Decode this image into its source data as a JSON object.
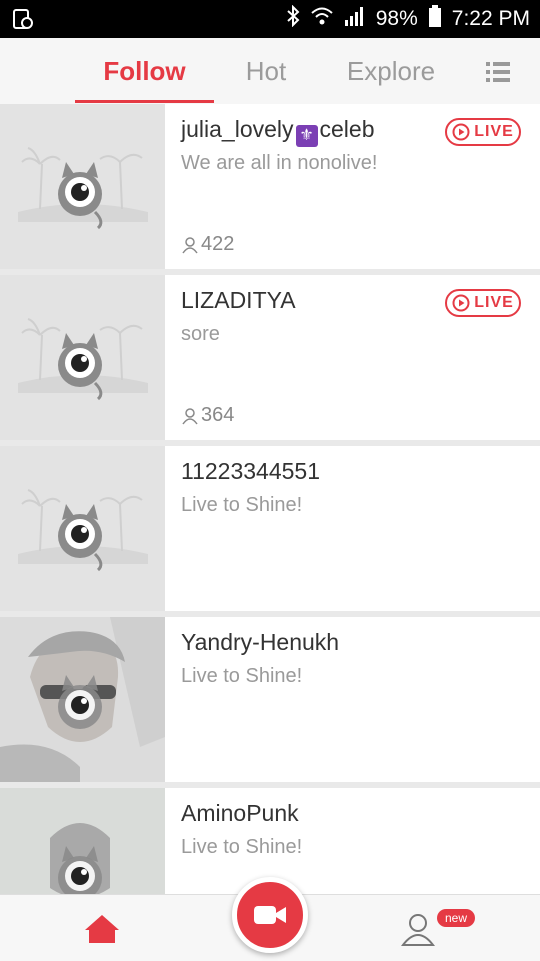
{
  "status_bar": {
    "battery": "98%",
    "time": "7:22 PM"
  },
  "tabs": [
    {
      "label": "Follow",
      "active": true
    },
    {
      "label": "Hot",
      "active": false
    },
    {
      "label": "Explore",
      "active": false
    }
  ],
  "live_label": "LIVE",
  "feed": [
    {
      "name_part1": "julia_lovely",
      "name_symbol": "⚜",
      "name_part2": "celeb",
      "bio": "We are all in nonolive!",
      "viewers": "422",
      "live": true
    },
    {
      "name": "LIZADITYA",
      "bio": "sore",
      "viewers": "364",
      "live": true
    },
    {
      "name": "11223344551",
      "bio": "Live to Shine!",
      "live": false
    },
    {
      "name": "Yandry-Henukh",
      "bio": "Live to Shine!",
      "live": false
    },
    {
      "name": "AminoPunk",
      "bio": "Live to Shine!",
      "live": false
    }
  ],
  "bottom_nav": {
    "new_badge": "new"
  },
  "colors": {
    "accent": "#e53a44",
    "background": "#e9e9e9"
  }
}
